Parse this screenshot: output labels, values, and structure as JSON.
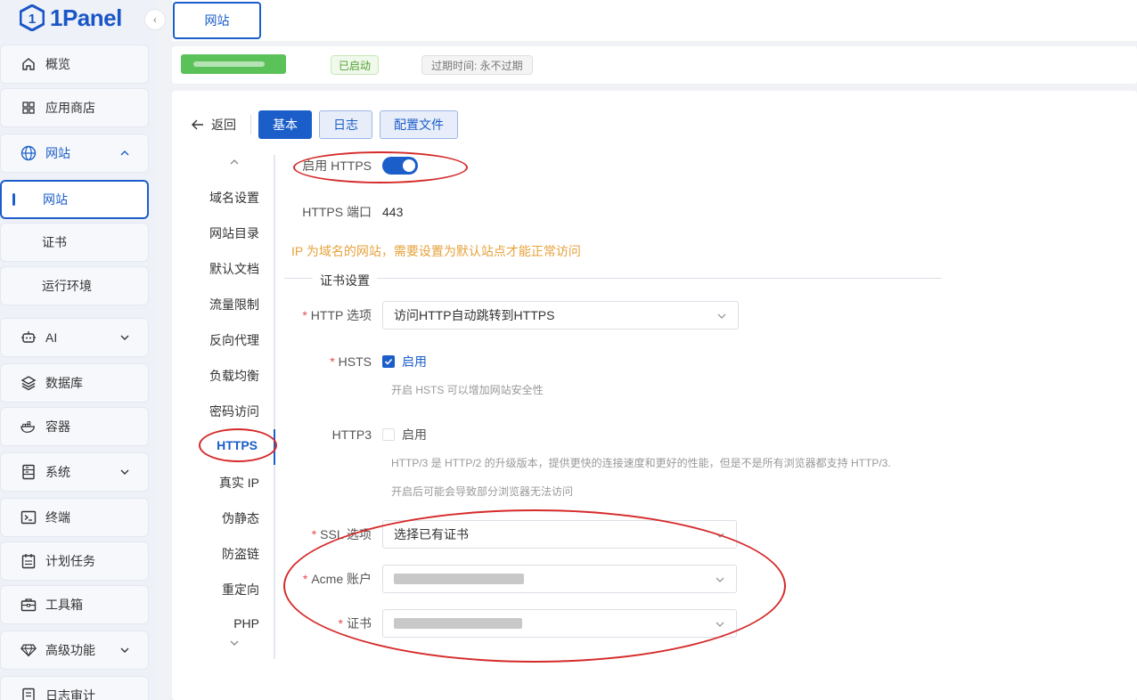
{
  "brand": {
    "name": "1Panel"
  },
  "sidebar": {
    "items": [
      {
        "label": "概览",
        "icon": "home-icon"
      },
      {
        "label": "应用商店",
        "icon": "grid-icon"
      },
      {
        "label": "网站",
        "icon": "globe-icon"
      },
      {
        "label": "AI",
        "icon": "robot-icon"
      },
      {
        "label": "数据库",
        "icon": "layers-icon"
      },
      {
        "label": "容器",
        "icon": "docker-icon"
      },
      {
        "label": "系统",
        "icon": "server-icon"
      },
      {
        "label": "终端",
        "icon": "terminal-icon"
      },
      {
        "label": "计划任务",
        "icon": "calendar-icon"
      },
      {
        "label": "工具箱",
        "icon": "toolbox-icon"
      },
      {
        "label": "高级功能",
        "icon": "diamond-icon"
      },
      {
        "label": "日志审计",
        "icon": "log-icon"
      }
    ],
    "website_sub": [
      "网站",
      "证书",
      "运行环境"
    ]
  },
  "tabs": {
    "current": "网站"
  },
  "site": {
    "status": "已启动",
    "expire": "过期时间: 永不过期"
  },
  "toolbar": {
    "back": "返回",
    "basic": "基本",
    "log": "日志",
    "config": "配置文件"
  },
  "subnav": [
    "域名设置",
    "网站目录",
    "默认文档",
    "流量限制",
    "反向代理",
    "负载均衡",
    "密码访问",
    "HTTPS",
    "真实 IP",
    "伪静态",
    "防盗链",
    "重定向",
    "PHP"
  ],
  "form": {
    "enable_https_label": "启用 HTTPS",
    "enable_https": true,
    "port_label": "HTTPS 端口",
    "port_value": "443",
    "ip_warning": "IP 为域名的网站，需要设置为默认站点才能正常访问",
    "cert_section": "证书设置",
    "http_option_label": "HTTP 选项",
    "http_option_value": "访问HTTP自动跳转到HTTPS",
    "hsts_label": "HSTS",
    "hsts_enable": "启用",
    "hsts_checked": true,
    "hsts_hint": "开启 HSTS 可以增加网站安全性",
    "http3_label": "HTTP3",
    "http3_enable": "启用",
    "http3_checked": false,
    "http3_hint1": "HTTP/3 是 HTTP/2 的升级版本，提供更快的连接速度和更好的性能，但是不是所有浏览器都支持 HTTP/3.",
    "http3_hint2": "开启后可能会导致部分浏览器无法访问",
    "ssl_label": "SSL 选项",
    "ssl_value": "选择已有证书",
    "acme_label": "Acme 账户",
    "cert_label": "证书"
  },
  "colors": {
    "primary": "#1b5ec9",
    "warning": "#e6a23c",
    "success": "#52a135",
    "annotation": "#d62a2a"
  }
}
